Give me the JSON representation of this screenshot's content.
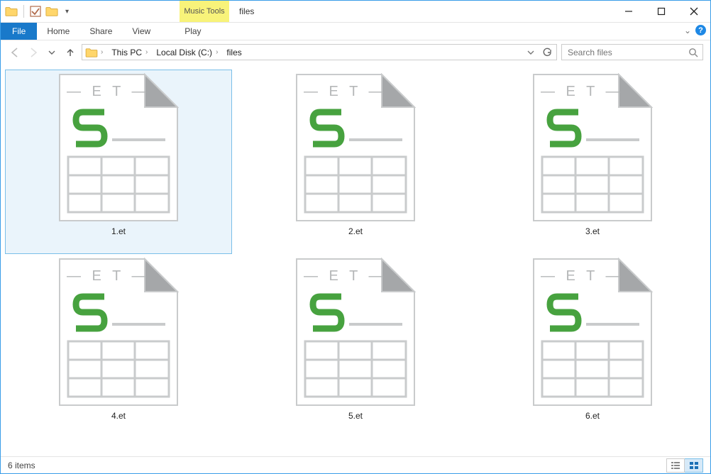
{
  "titlebar": {
    "contextual_label": "Music Tools",
    "window_title": "files"
  },
  "ribbon": {
    "file": "File",
    "home": "Home",
    "share": "Share",
    "view": "View",
    "play": "Play"
  },
  "breadcrumb": {
    "segments": [
      "This PC",
      "Local Disk (C:)",
      "files"
    ]
  },
  "search": {
    "placeholder": "Search files"
  },
  "files": [
    {
      "name": "1.et",
      "selected": true
    },
    {
      "name": "2.et",
      "selected": false
    },
    {
      "name": "3.et",
      "selected": false
    },
    {
      "name": "4.et",
      "selected": false
    },
    {
      "name": "5.et",
      "selected": false
    },
    {
      "name": "6.et",
      "selected": false
    }
  ],
  "status": {
    "count_label": "6 items"
  }
}
